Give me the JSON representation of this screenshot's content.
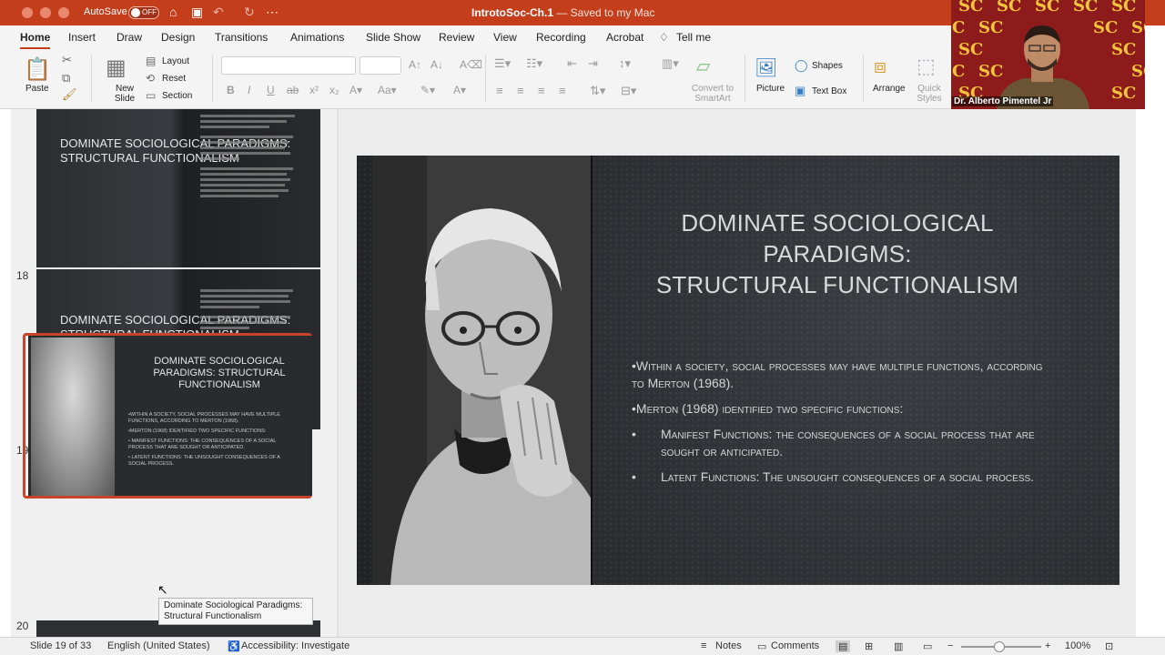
{
  "titlebar": {
    "autosave_label": "AutoSave",
    "autosave_state": "OFF",
    "doc_name": "IntrotoSoc-Ch.1",
    "saved_status": " — Saved to my Mac",
    "icons": [
      "home-icon",
      "save-icon",
      "undo-icon",
      "redo-icon",
      "more-icon"
    ]
  },
  "tabs": [
    "Home",
    "Insert",
    "Draw",
    "Design",
    "Transitions",
    "Animations",
    "Slide Show",
    "Review",
    "View",
    "Recording",
    "Acrobat",
    "Tell me"
  ],
  "ribbon": {
    "paste": "Paste",
    "new_slide": "New Slide",
    "layout": "Layout",
    "reset": "Reset",
    "section": "Section",
    "convert_smartart": "Convert to SmartArt",
    "picture": "Picture",
    "shapes": "Shapes",
    "text_box": "Text Box",
    "arrange": "Arrange",
    "quick_styles": "Quick Styles"
  },
  "video": {
    "presenter": "Dr. Alberto Pimentel Jr"
  },
  "thumbnails": {
    "slide17_title": "Dominate Sociological Paradigms: Structural Functionalism",
    "slide18_num": "18",
    "slide18_title": "Dominate Sociological Paradigms: Structural Functionalism",
    "slide19_num": "19",
    "slide19_title": "Dominate Sociological Paradigms: Structural Functionalism",
    "slide19_body": [
      "•Within a society, social processes may have multiple functions, according to Merton (1968).",
      "•Merton (1968) identified two specific functions:",
      "•   Manifest Functions: The consequences of a social process that are sought or anticipated.",
      "•   Latent Functions: The unsought consequences of a social process."
    ],
    "slide20_num": "20",
    "tooltip": "Dominate Sociological Paradigms: Structural Functionalism"
  },
  "slide": {
    "title_line1": "Dominate Sociological",
    "title_line2": "Paradigms:",
    "title_line3": "Structural Functionalism",
    "bullet1": "•Within a society, social processes may have multiple functions, according to Merton (1968).",
    "bullet2": "•Merton (1968) identified two specific functions:",
    "sub1": "Manifest Functions: the consequences of a social process that are sought or anticipated.",
    "sub2": "Latent Functions: The unsought consequences of a social process.",
    "sub_bullet": "•"
  },
  "statusbar": {
    "slide_pos": "Slide 19 of 33",
    "language": "English (United States)",
    "accessibility": "Accessibility: Investigate",
    "notes": "Notes",
    "comments": "Comments",
    "zoom": "100%"
  },
  "colors": {
    "accent": "#c43e1c",
    "selection": "#c7442a",
    "slide_bg": "#2e2f33"
  }
}
